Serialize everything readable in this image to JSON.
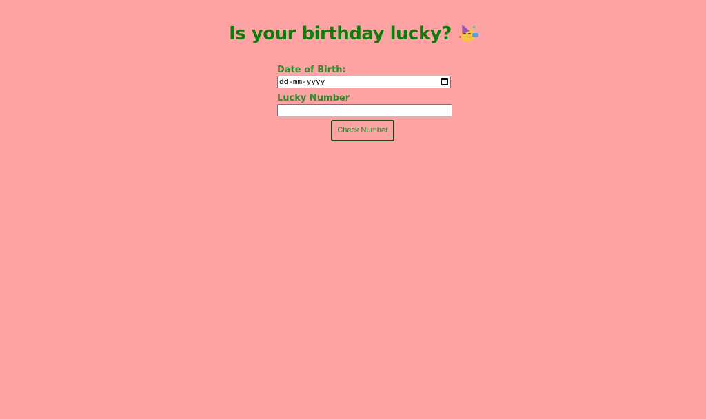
{
  "header": {
    "title": "Is your birthday lucky?",
    "emoji_icon": "partying-face-icon"
  },
  "form": {
    "dob_label": "Date of Birth:",
    "dob_value": "dd-mm-yyyy",
    "lucky_label": "Lucky Number",
    "lucky_value": "",
    "submit_label": "Check Number"
  },
  "colors": {
    "background": "#fea3a3",
    "title": "#0b7d0b",
    "label": "#2e8b2e",
    "button_border": "#174d17"
  }
}
